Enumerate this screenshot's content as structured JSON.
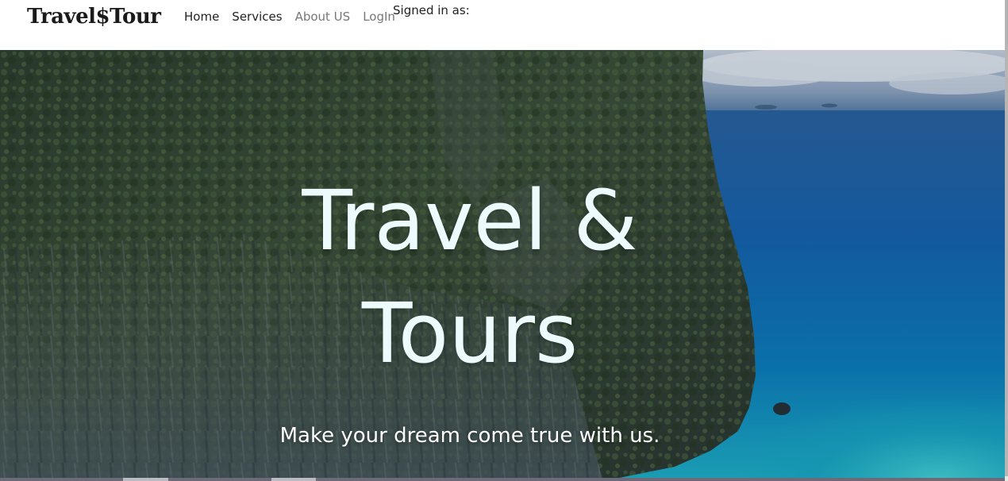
{
  "navbar": {
    "brand": "Travel$Tour",
    "links": [
      {
        "label": "Home"
      },
      {
        "label": "Services"
      },
      {
        "label": "About US"
      },
      {
        "label": "LogIn"
      }
    ],
    "signed_in_label": "Signed in as:"
  },
  "hero": {
    "title_line1": "Travel &",
    "title_line2": "Tours",
    "tagline": "Make your dream come true with us."
  },
  "colors": {
    "title_text": "#eefbfd",
    "nav_active": "#222222",
    "nav_muted": "#777777",
    "sea": "#1a73b5",
    "cliff": "#3c4a3a"
  }
}
